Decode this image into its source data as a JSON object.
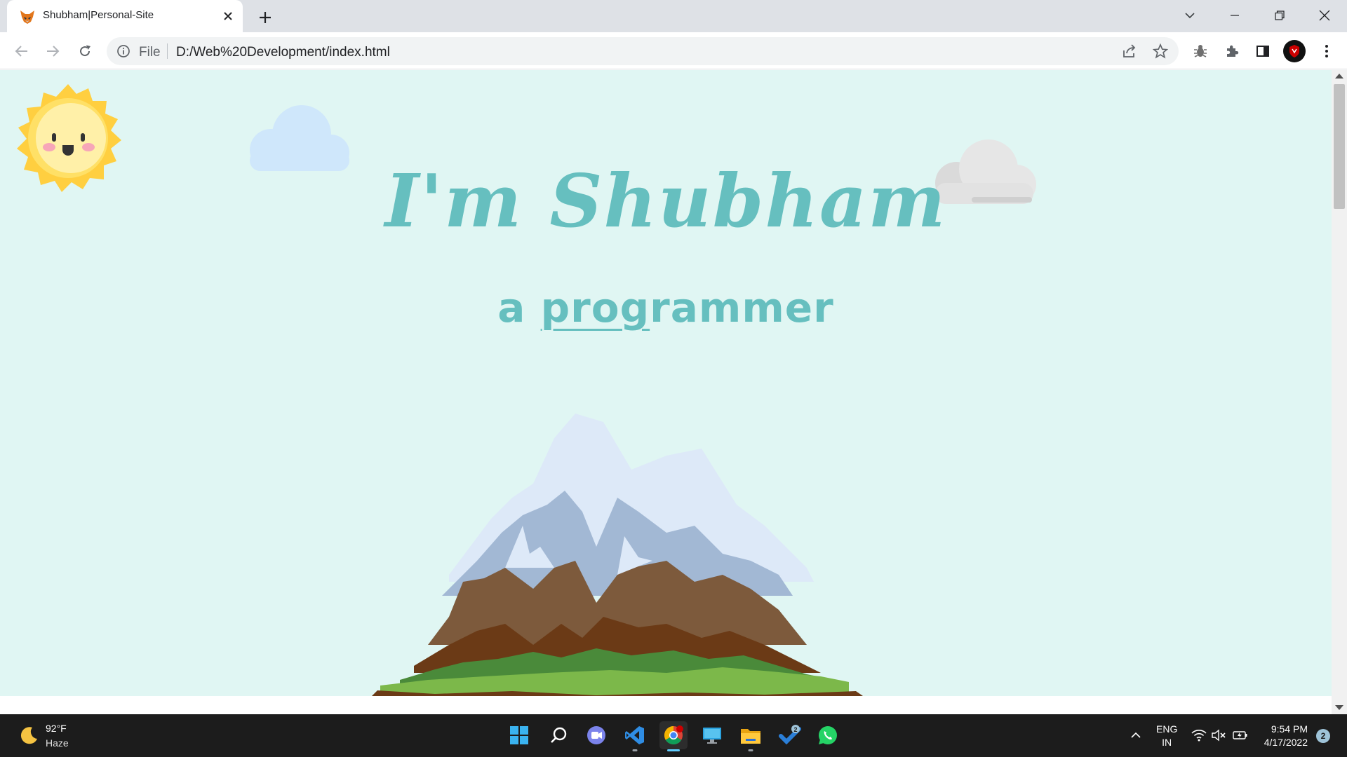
{
  "browser": {
    "tab": {
      "title": "Shubham|Personal-Site",
      "favicon": "fox-icon"
    },
    "address": {
      "scheme_label": "File",
      "url": "D:/Web%20Development/index.html"
    },
    "colors": {
      "tabstrip": "#dee1e6",
      "omnibox": "#f1f3f4",
      "profile": "#cc0000"
    }
  },
  "page": {
    "title": "I'm Shubham",
    "subtitle_prefix": "a ",
    "subtitle_underlined": "prog",
    "subtitle_rest": "rammer",
    "colors": {
      "background": "#e0f6f3",
      "text": "#66bfbf"
    }
  },
  "taskbar": {
    "weather": {
      "temp": "92°F",
      "desc": "Haze"
    },
    "language": {
      "line1": "ENG",
      "line2": "IN"
    },
    "clock": {
      "time": "9:54 PM",
      "date": "4/17/2022"
    },
    "notifications": "2",
    "todo_badge": "2",
    "apps": [
      "start-icon",
      "search-icon",
      "teams-chat-icon",
      "vscode-icon",
      "chrome-icon",
      "remote-desktop-icon",
      "file-explorer-icon",
      "todo-icon",
      "whatsapp-icon"
    ]
  }
}
